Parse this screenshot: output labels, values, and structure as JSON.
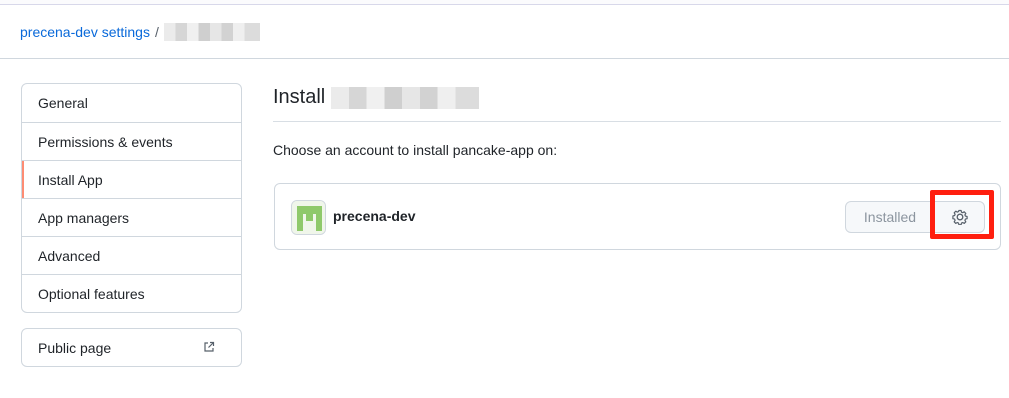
{
  "breadcrumb": {
    "settings_link": "precena-dev settings",
    "separator": "/"
  },
  "sidebar": {
    "items": [
      {
        "label": "General"
      },
      {
        "label": "Permissions & events"
      },
      {
        "label": "Install App"
      },
      {
        "label": "App managers"
      },
      {
        "label": "Advanced"
      },
      {
        "label": "Optional features"
      }
    ],
    "active_index": 2,
    "public_page": "Public page"
  },
  "main": {
    "title": "Install",
    "choose_text": "Choose an account to install pancake-app on:",
    "account": {
      "name": "precena-dev",
      "installed_label": "Installed"
    }
  },
  "colors": {
    "link": "#0969da",
    "active_marker": "#fd8c73",
    "highlight": "#ff1f0f",
    "avatar_green": "#8fc96b"
  },
  "icons": [
    "external-link-icon",
    "gear-icon",
    "account-avatar"
  ]
}
